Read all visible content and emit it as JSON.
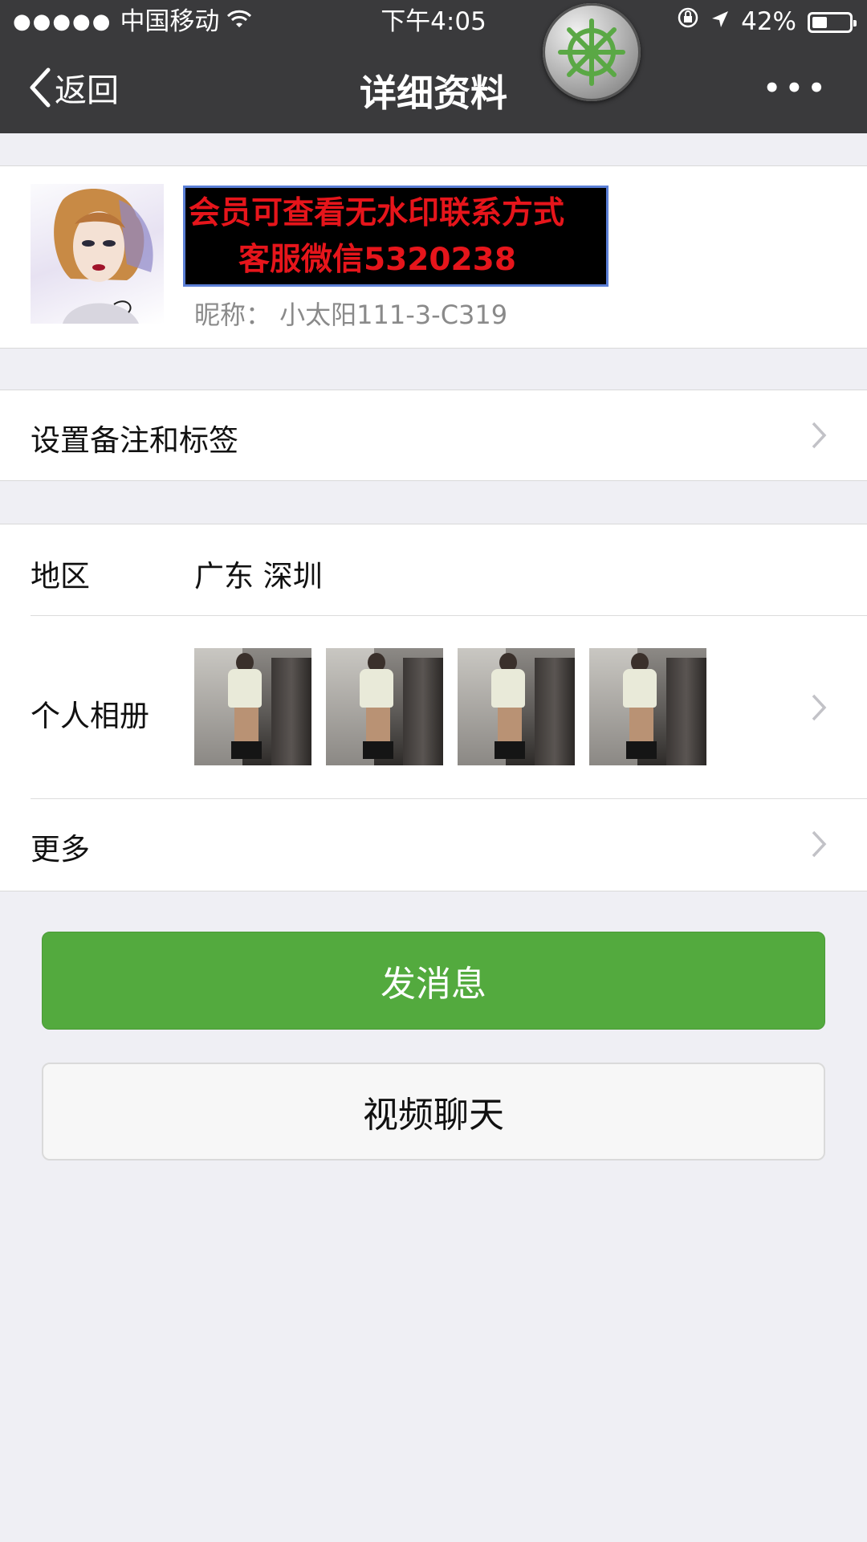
{
  "status_bar": {
    "signal": "●●●●●",
    "carrier": "中国移动",
    "time": "下午4:05",
    "battery": "42%",
    "battery_level": 0.42
  },
  "nav": {
    "back_label": "返回",
    "title": "详细资料",
    "more_label": "•••"
  },
  "profile": {
    "watermark_line1": "会员可查看无水印联系方式",
    "watermark_line2": "客服微信5320238",
    "nickname": "昵称：  小太阳111-3-C319"
  },
  "rows": {
    "remark_label": "设置备注和标签",
    "region_label": "地区",
    "region_value": "广东  深圳",
    "album_label": "个人相册",
    "more_label": "更多"
  },
  "buttons": {
    "send_message": "发消息",
    "video_chat": "视频聊天"
  },
  "colors": {
    "accent_green": "#53aa3e",
    "nav_bg": "#3a3a3c",
    "page_bg": "#efeff4",
    "watermark_red": "#e6151b"
  },
  "icons": [
    "wifi-icon",
    "orientation-lock-icon",
    "location-arrow-icon",
    "battery-icon",
    "helm-icon",
    "back-chevron-icon",
    "more-dots-icon",
    "chevron-right-icon"
  ]
}
